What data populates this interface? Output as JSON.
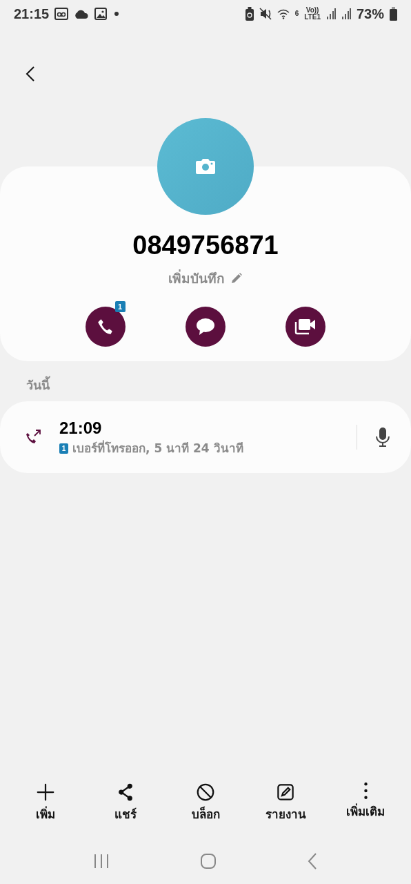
{
  "status_bar": {
    "time": "21:15",
    "network_gen": "6",
    "volte": "Vo))",
    "lte": "LTE1",
    "battery": "73%"
  },
  "contact": {
    "number": "0849756871",
    "note_action": "เพิ่มบันทึก",
    "call_sim_badge": "1"
  },
  "history": {
    "heading": "วันนี้",
    "entries": [
      {
        "time": "21:09",
        "sim": "1",
        "detail": "เบอร์ที่โทรออก, 5 นาที 24 วินาที"
      }
    ]
  },
  "toolbar": [
    {
      "kind": "add",
      "label": "เพิ่ม"
    },
    {
      "kind": "share",
      "label": "แชร์"
    },
    {
      "kind": "block",
      "label": "บล็อก"
    },
    {
      "kind": "report",
      "label": "รายงาน"
    },
    {
      "kind": "more",
      "label": "เพิ่มเติม"
    }
  ]
}
